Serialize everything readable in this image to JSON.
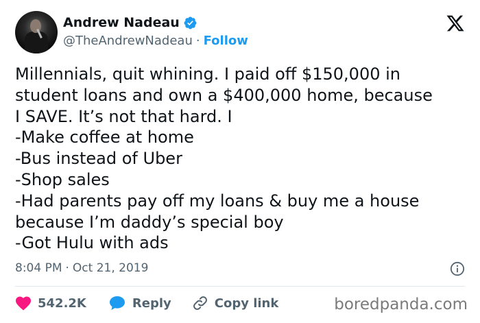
{
  "author": {
    "name": "Andrew Nadeau",
    "handle": "@TheAndrewNadeau",
    "separator": "·",
    "follow_label": "Follow",
    "verified_color": "#1d9bf0"
  },
  "icons": {
    "logo": "x-logo-icon",
    "verified": "verified-badge-icon",
    "info": "info-icon",
    "like": "heart-icon",
    "reply": "speech-bubble-icon",
    "copy": "link-icon"
  },
  "tweet": {
    "lines": [
      "Millennials, quit whining. I paid off $150,000 in",
      "student loans and own a $400,000 home, because",
      "I SAVE. It’s not that hard. I",
      "-Make coffee at home",
      "-Bus instead of Uber",
      "-Shop sales",
      "-Had parents pay off my loans & buy me a house",
      "because I’m daddy’s special boy",
      "-Got Hulu with ads"
    ],
    "time": "8:04 PM",
    "date_separator": "·",
    "date": "Oct 21, 2019"
  },
  "actions": {
    "like_count": "542.2K",
    "reply_label": "Reply",
    "copy_link_label": "Copy link"
  },
  "watermark": "boredpanda.com",
  "colors": {
    "like": "#f91880",
    "accent": "#1d9bf0",
    "secondary_text": "#536471"
  }
}
